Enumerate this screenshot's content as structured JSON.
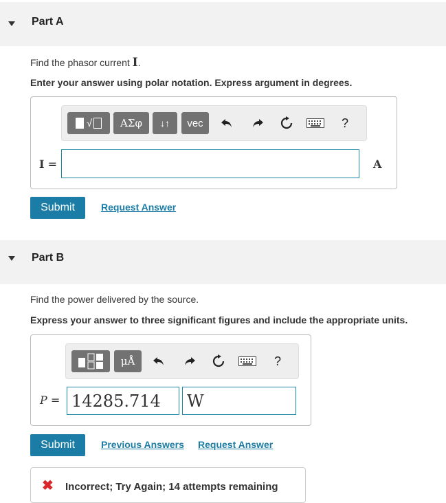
{
  "partA": {
    "title": "Part A",
    "prompt_text": "Find the phasor current ",
    "prompt_var": "I",
    "prompt_end": ".",
    "instruction": "Enter your answer using polar notation. Express argument in degrees.",
    "toolbar": {
      "templates": "√",
      "greek": "ΑΣφ",
      "arrows": "↓↑",
      "vec": "vec",
      "help": "?"
    },
    "label_var": "I",
    "label_eq": " =",
    "answer_value": "",
    "unit": "A",
    "submit_label": "Submit",
    "request_label": "Request Answer"
  },
  "partB": {
    "title": "Part B",
    "prompt": "Find the power delivered by the source.",
    "instruction": "Express your answer to three significant figures and include the appropriate units.",
    "toolbar": {
      "units": "μÅ",
      "help": "?"
    },
    "label_var": "P",
    "label_eq": " =",
    "value": "14285.714",
    "unit_value": "W",
    "submit_label": "Submit",
    "previous_label": "Previous Answers",
    "request_label": "Request Answer",
    "feedback": "Incorrect; Try Again; 14 attempts remaining",
    "feedback_icon": "✖"
  },
  "colors": {
    "accent": "#1b7da5",
    "error": "#d9262b",
    "header_bg": "#f2f2f2"
  }
}
